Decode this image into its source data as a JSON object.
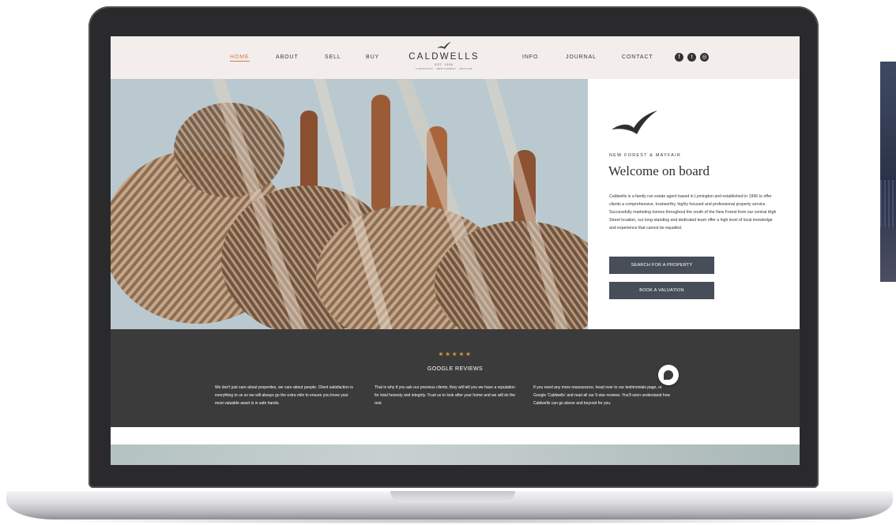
{
  "colors": {
    "header_bg": "#f3eeec",
    "accent": "#d27a45",
    "button_bg": "#474e5a",
    "reviews_bg": "#3b3b3c",
    "star": "#c9973f"
  },
  "nav": {
    "home": "HOME",
    "about": "ABOUT",
    "sell": "SELL",
    "buy": "BUY",
    "info": "INFO",
    "journal": "JOURNAL",
    "contact": "CONTACT",
    "social_icons": [
      "facebook-icon",
      "twitter-icon",
      "instagram-icon"
    ],
    "social_glyphs": [
      "f",
      "t",
      "◎"
    ]
  },
  "logo": {
    "word": "CALDWELLS",
    "est": "EST. 1996",
    "places": "LYMINGTON · NEW FOREST · MAYFAIR"
  },
  "hero": {
    "eyebrow": "NEW FOREST & MAYFAIR",
    "title": "Welcome on board",
    "body": "Caldwells is a family run estate agent based in Lymington and established in 1996 to offer clients a comprehensive, trustworthy, highly focused and professional property service. Successfully marketing homes throughout the south of the New Forest from our central High Street location, our long-standing and dedicated team offer a high level of local knowledge and experience that cannot be equalled.",
    "btn_search": "SEARCH FOR A PROPERTY",
    "btn_valuation": "BOOK A VALUATION"
  },
  "reviews": {
    "stars": "★★★★★",
    "title": "GOOGLE REVIEWS",
    "col1": "We don't just care about properties, we care about people. Client satisfaction is everything to us so we will always go the extra mile to ensure you know your most valuable asset is in safe hands.",
    "col2": "That is why if you ask our previous clients, they will tell you we have a reputation for total honesty and integrity. Trust us to look after your home and we will do the rest.",
    "col3": "If you need any more reassurance, head over to our testimonials page, or Google 'Caldwells' and read all our 5-star reviews. You'll soon understand how Caldwells can go above and beyond for you."
  }
}
